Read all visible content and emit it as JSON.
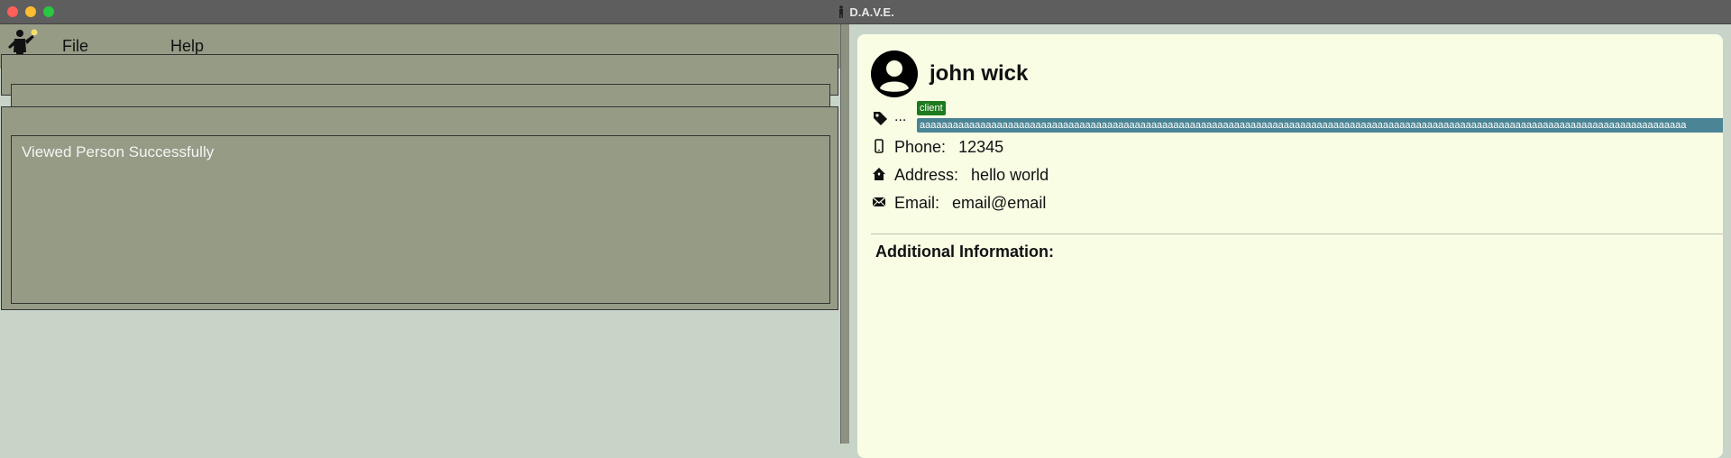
{
  "window": {
    "title": "D.A.V.E."
  },
  "menu": {
    "file_label": "File",
    "help_label": "Help"
  },
  "command": {
    "value": "",
    "placeholder": ""
  },
  "result": {
    "message": "Viewed Person Successfully"
  },
  "person": {
    "name": "john wick",
    "tags_ellipsis": "...",
    "tags": [
      "client",
      "aaaaaaaaaaaaaaaaaaaaaaaaaaaaaaaaaaaaaaaaaaaaaaaaaaaaaaaaaaaaaaaaaaaaaaaaaaaaaaaaaaaaaaaaaaaaaaaaaaaaaaaaaaaaaaaaaaaaaaaaaaaaaaaaaaaaaaaaaaa"
    ],
    "phone_label": "Phone:",
    "phone": "12345",
    "address_label": "Address:",
    "address": "hello world",
    "email_label": "Email:",
    "email": "email@email",
    "additional_title": "Additional Information:"
  },
  "colors": {
    "tag_client": "#1f7a1f",
    "tag_other": "#4b8595",
    "panel_bg": "#f8fde4",
    "menu_bg": "#969b86"
  },
  "icons": [
    "app-logo-icon",
    "tag-icon",
    "phone-icon",
    "home-icon",
    "mail-icon",
    "person-avatar-icon"
  ]
}
